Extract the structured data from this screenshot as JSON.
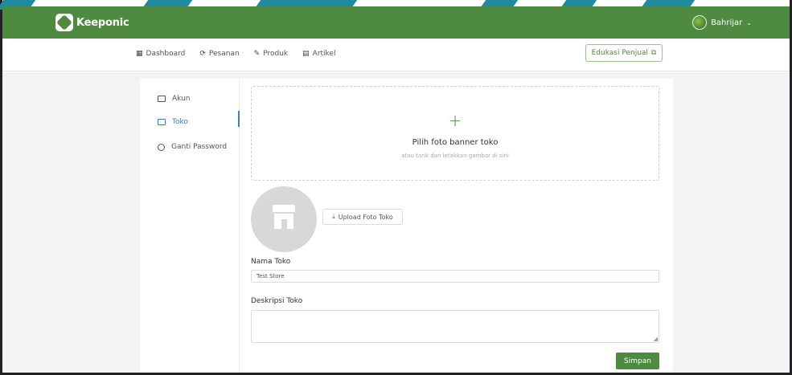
{
  "brand": {
    "name": "Keeponic"
  },
  "user": {
    "name": "Bahrijar",
    "caret": "⌄"
  },
  "nav": {
    "items": [
      {
        "label": "Dashboard",
        "icon": "▦"
      },
      {
        "label": "Pesanan",
        "icon": "⟳"
      },
      {
        "label": "Produk",
        "icon": "✎"
      },
      {
        "label": "Artikel",
        "icon": "▤"
      }
    ],
    "edu_button": "Edukasi Penjual",
    "edu_icon": "⧉"
  },
  "sidebar": {
    "items": [
      {
        "label": "Akun"
      },
      {
        "label": "Toko"
      },
      {
        "label": "Ganti Password"
      }
    ],
    "active": "Toko"
  },
  "banner": {
    "plus": "+",
    "title": "Pilih foto banner toko",
    "subtitle": "atau tarik dan letakkan gambar di sini"
  },
  "upload": {
    "label": "Upload Foto Toko",
    "icon": "⤓"
  },
  "form": {
    "name_label": "Nama Toko",
    "name_value": "Test Store",
    "desc_label": "Deskripsi Toko",
    "desc_value": ""
  },
  "save_button": "Simpan",
  "colors": {
    "primary": "#4e8a3f",
    "active": "#3b7fc4",
    "background": "#f1f3f5"
  }
}
